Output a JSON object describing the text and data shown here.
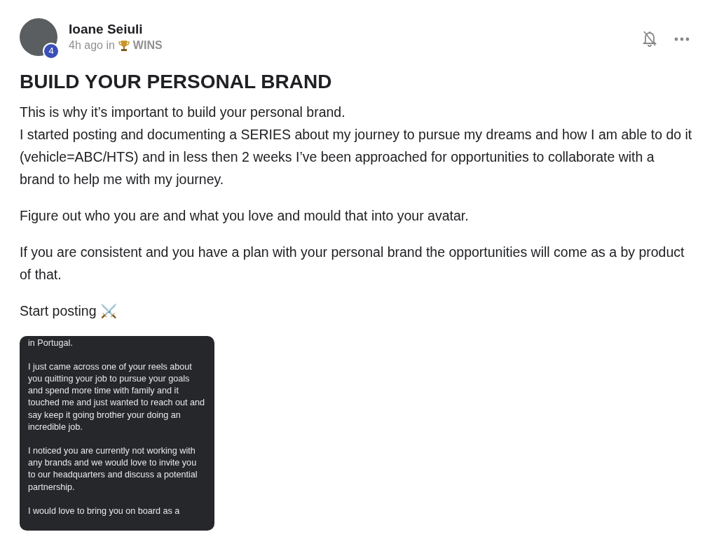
{
  "post": {
    "author": "Ioane Seiuli",
    "level_badge": "4",
    "time": "4h ago in",
    "category": "WINS",
    "title": "BUILD YOUR PERSONAL BRAND",
    "paragraphs": [
      "This is why it’s important to build your personal brand.\nI started posting and documenting a SERIES about my journey to pursue my dreams and how I am able to do it (vehicle=ABC/HTS) and in less then 2 weeks I’ve been approached for opportunities to collaborate with a brand to help me with my journey.",
      "Figure out who you are and what you love and mould that into your avatar.",
      "If you are consistent and you have a plan with your personal brand the opportunities will come as a by product of that.",
      "Start posting ⚔️"
    ],
    "attachment": {
      "paragraphs": [
        "in Portugal.",
        "I just came across one of your reels about you quitting your job to pursue your goals and spend more time with family and it touched me and just wanted to reach out and say keep it going brother your doing an incredible job.",
        "I noticed you are currently not working with any brands and we would love to invite you to our headquarters and discuss a potential partnership.",
        "I would love to bring you on board as a"
      ]
    }
  }
}
